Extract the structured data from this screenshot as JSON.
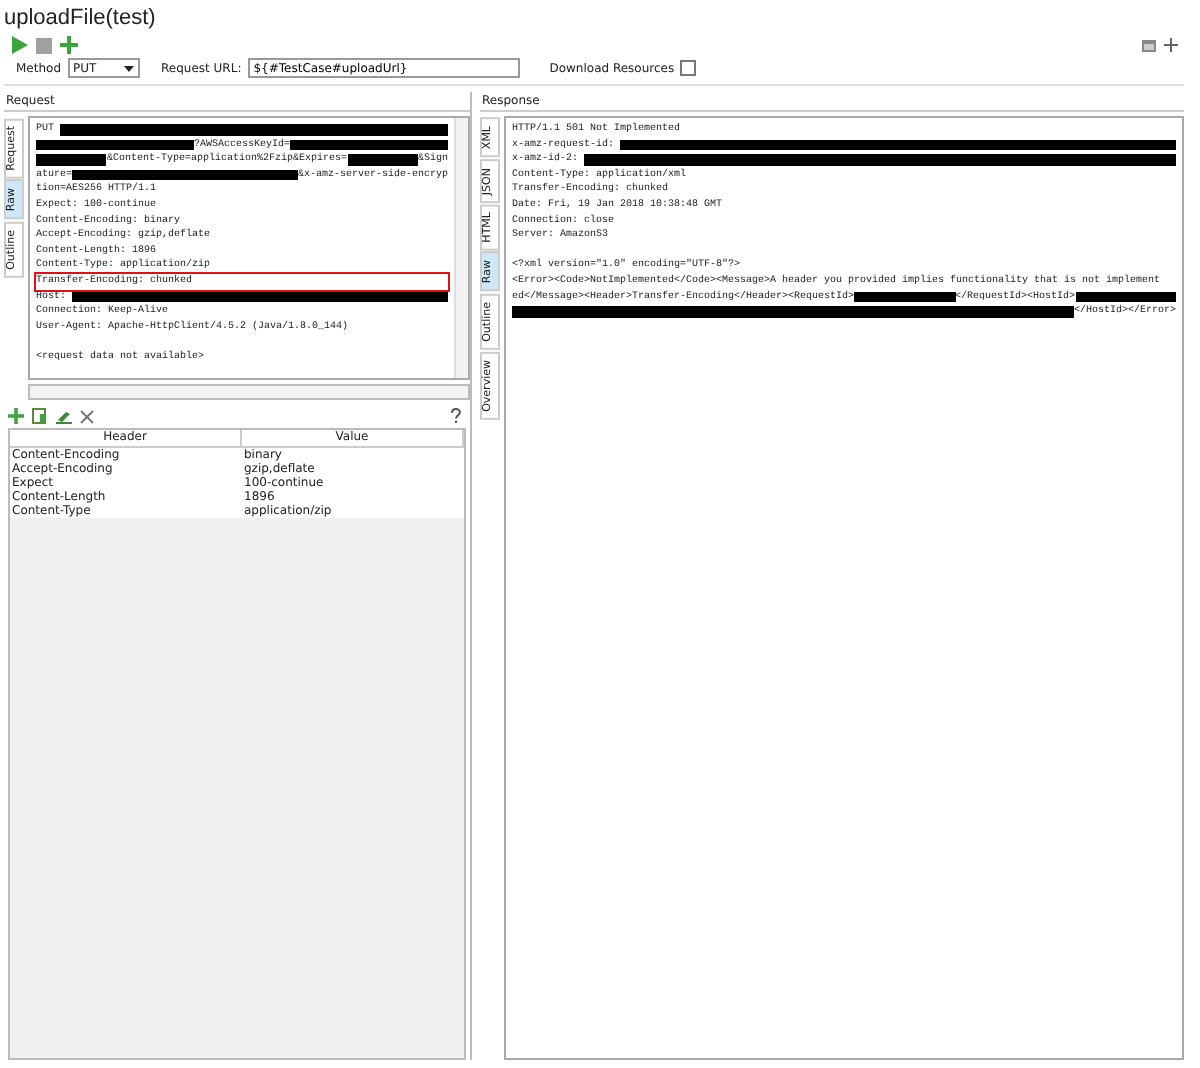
{
  "title": "uploadFile(test)",
  "request_bar": {
    "method_label": "Method",
    "method": "PUT",
    "url_label": "Request URL:",
    "url": "${#TestCase#uploadUrl}",
    "download_label": "Download Resources",
    "download_checked": false
  },
  "request": {
    "label": "Request",
    "tabs": [
      {
        "label": "Request",
        "selected": false
      },
      {
        "label": "Raw",
        "selected": true
      },
      {
        "label": "Outline",
        "selected": false
      }
    ],
    "lines": [
      {
        "segments": [
          {
            "kind": "text",
            "text": "PUT "
          },
          {
            "kind": "redacted"
          }
        ]
      },
      {
        "segments": [
          {
            "kind": "redacted"
          },
          {
            "kind": "text",
            "text": "?AWSAccessKeyId="
          },
          {
            "kind": "redacted"
          }
        ]
      },
      {
        "segments": [
          {
            "kind": "redacted"
          },
          {
            "kind": "text",
            "text": "&Content-Type=application%2Fzip&Expires="
          },
          {
            "kind": "redacted"
          },
          {
            "kind": "text",
            "text": "&Sign"
          }
        ]
      },
      {
        "segments": [
          {
            "kind": "text",
            "text": "ature="
          },
          {
            "kind": "redacted"
          },
          {
            "kind": "text",
            "text": "&x-amz-server-side-encryp"
          }
        ]
      },
      {
        "segments": [
          {
            "kind": "text",
            "text": "tion=AES256 HTTP/1.1"
          }
        ]
      },
      {
        "segments": [
          {
            "kind": "text",
            "text": "Expect: 100-continue"
          }
        ]
      },
      {
        "segments": [
          {
            "kind": "text",
            "text": "Content-Encoding: binary"
          }
        ]
      },
      {
        "segments": [
          {
            "kind": "text",
            "text": "Accept-Encoding: gzip,deflate"
          }
        ]
      },
      {
        "segments": [
          {
            "kind": "text",
            "text": "Content-Length: 1896"
          }
        ]
      },
      {
        "segments": [
          {
            "kind": "text",
            "text": "Content-Type: application/zip"
          }
        ]
      },
      {
        "highlighted": true,
        "segments": [
          {
            "kind": "text",
            "text": "Transfer-Encoding: chunked"
          }
        ]
      },
      {
        "segments": [
          {
            "kind": "text",
            "text": "Host: "
          },
          {
            "kind": "redacted"
          }
        ]
      },
      {
        "segments": [
          {
            "kind": "text",
            "text": "Connection: Keep-Alive"
          }
        ]
      },
      {
        "segments": [
          {
            "kind": "text",
            "text": "User-Agent: Apache-HttpClient/4.5.2 (Java/1.8.0_144)"
          }
        ]
      },
      {
        "gap_before": true,
        "segments": [
          {
            "kind": "text",
            "text": "<request data not available>"
          }
        ]
      }
    ],
    "table": {
      "columns": [
        "Header",
        "Value"
      ],
      "rows": [
        [
          "Content-Encoding",
          "binary"
        ],
        [
          "Accept-Encoding",
          "gzip,deflate"
        ],
        [
          "Expect",
          "100-continue"
        ],
        [
          "Content-Length",
          "1896"
        ],
        [
          "Content-Type",
          "application/zip"
        ]
      ]
    }
  },
  "response": {
    "label": "Response",
    "tabs": [
      {
        "label": "XML",
        "selected": false
      },
      {
        "label": "JSON",
        "selected": false
      },
      {
        "label": "HTML",
        "selected": false
      },
      {
        "label": "Raw",
        "selected": true
      },
      {
        "label": "Outline",
        "selected": false
      },
      {
        "label": "Overview",
        "selected": false
      }
    ],
    "lines": [
      {
        "segments": [
          {
            "kind": "text",
            "text": "HTTP/1.1 501 Not Implemented"
          }
        ]
      },
      {
        "segments": [
          {
            "kind": "text",
            "text": "x-amz-request-id: "
          },
          {
            "kind": "redacted"
          }
        ]
      },
      {
        "segments": [
          {
            "kind": "text",
            "text": "x-amz-id-2: "
          },
          {
            "kind": "redacted"
          }
        ]
      },
      {
        "segments": [
          {
            "kind": "text",
            "text": "Content-Type: application/xml"
          }
        ]
      },
      {
        "segments": [
          {
            "kind": "text",
            "text": "Transfer-Encoding: chunked"
          }
        ]
      },
      {
        "segments": [
          {
            "kind": "text",
            "text": "Date: Fri, 19 Jan 2018 10:38:48 GMT"
          }
        ]
      },
      {
        "segments": [
          {
            "kind": "text",
            "text": "Connection: close"
          }
        ]
      },
      {
        "segments": [
          {
            "kind": "text",
            "text": "Server: AmazonS3"
          }
        ]
      },
      {
        "gap_before": true,
        "segments": [
          {
            "kind": "text",
            "text": "<?xml version=\"1.0\" encoding=\"UTF-8\"?>"
          }
        ]
      },
      {
        "segments": [
          {
            "kind": "text",
            "text": "<Error><Code>NotImplemented</Code><Message>A header you provided implies functionality that is not implement"
          }
        ]
      },
      {
        "segments": [
          {
            "kind": "text",
            "text": "ed</Message><Header>Transfer-Encoding</Header><RequestId>"
          },
          {
            "kind": "redacted"
          },
          {
            "kind": "text",
            "text": "</RequestId><HostId>"
          },
          {
            "kind": "redacted"
          }
        ]
      },
      {
        "segments": [
          {
            "kind": "redacted"
          },
          {
            "kind": "text",
            "text": "</HostId></Error>"
          }
        ]
      }
    ]
  }
}
